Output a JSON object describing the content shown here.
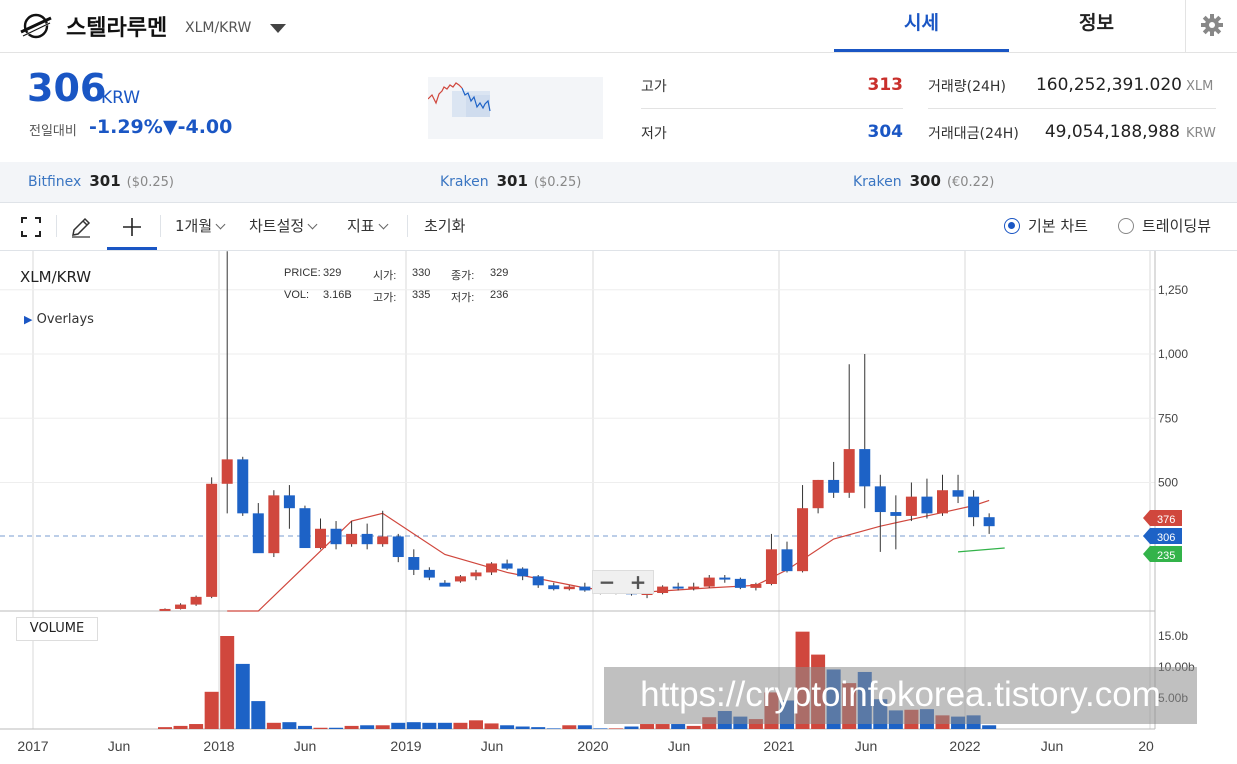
{
  "header": {
    "coin_name": "스텔라루멘",
    "pair": "XLM/KRW",
    "tabs": [
      "시세",
      "정보"
    ]
  },
  "quote": {
    "price": "306",
    "unit": "KRW",
    "change_label": "전일대비",
    "change_pct": "-1.29%",
    "change_abs": "▼-4.00",
    "high_label": "고가",
    "high": "313",
    "low_label": "저가",
    "low": "304",
    "volume_label": "거래량(24H)",
    "volume": "160,252,391.020",
    "volume_unit": "XLM",
    "turnover_label": "거래대금(24H)",
    "turnover": "49,054,188,988",
    "turnover_unit": "KRW"
  },
  "exchanges": [
    {
      "name": "Bitfinex",
      "price": "301",
      "sub": "($0.25)"
    },
    {
      "name": "Kraken",
      "price": "301",
      "sub": "($0.25)"
    },
    {
      "name": "Kraken",
      "price": "300",
      "sub": "(€0.22)"
    }
  ],
  "toolbar": {
    "period": "1개월",
    "chart_settings": "차트설정",
    "indicators": "지표",
    "reset": "초기화",
    "basic_chart": "기본 차트",
    "tradingview": "트레이딩뷰"
  },
  "chart_panel": {
    "title": "XLM/KRW",
    "overlays": "Overlays",
    "info": {
      "price_label": "PRICE:",
      "price": "329",
      "open_label": "시가:",
      "open": "330",
      "close_label": "종가:",
      "close": "329",
      "vol_label": "VOL:",
      "vol": "3.16B",
      "high_label": "고가:",
      "high": "335",
      "low_label": "저가:",
      "low": "236"
    },
    "volume_label": "VOLUME",
    "price_tags": {
      "upper": "376",
      "current": "306",
      "lower": "235"
    },
    "watermark": "https://cryptoinfokorea.tistory.com",
    "zoom_out": "−",
    "zoom_in": "+"
  },
  "colors": {
    "up": "#d0473d",
    "down": "#1d62c6",
    "accent": "#1a56c4",
    "ma": "#d0473d",
    "ma2": "#33b34a"
  },
  "chart_data": {
    "type": "candlestick",
    "title": "XLM/KRW",
    "x_ticks": [
      "2017",
      "Jun",
      "2018",
      "Jun",
      "2019",
      "Jun",
      "2020",
      "Jun",
      "2021",
      "Jun",
      "2022",
      "Jun",
      "20"
    ],
    "y_ticks": [
      "1,250",
      "1,000",
      "750",
      "500"
    ],
    "ylim": [
      -40,
      1400
    ],
    "volume_ticks": [
      "15.0b",
      "10.00b",
      "5.00b"
    ],
    "volume_max": 15.0,
    "start_month": "2017-11",
    "candles": [
      {
        "o": 5,
        "h": 10,
        "l": 3,
        "c": 8
      },
      {
        "o": 8,
        "h": 30,
        "l": 6,
        "c": 25
      },
      {
        "o": 25,
        "h": 60,
        "l": 20,
        "c": 55
      },
      {
        "o": 55,
        "h": 520,
        "l": 50,
        "c": 495
      },
      {
        "o": 495,
        "h": 1400,
        "l": 380,
        "c": 590
      },
      {
        "o": 590,
        "h": 600,
        "l": 370,
        "c": 380
      },
      {
        "o": 380,
        "h": 420,
        "l": 300,
        "c": 225
      },
      {
        "o": 225,
        "h": 470,
        "l": 210,
        "c": 450
      },
      {
        "o": 450,
        "h": 490,
        "l": 320,
        "c": 400
      },
      {
        "o": 400,
        "h": 410,
        "l": 250,
        "c": 245
      },
      {
        "o": 245,
        "h": 360,
        "l": 240,
        "c": 320
      },
      {
        "o": 320,
        "h": 350,
        "l": 240,
        "c": 260
      },
      {
        "o": 260,
        "h": 350,
        "l": 250,
        "c": 300
      },
      {
        "o": 300,
        "h": 340,
        "l": 240,
        "c": 260
      },
      {
        "o": 260,
        "h": 390,
        "l": 250,
        "c": 290
      },
      {
        "o": 290,
        "h": 300,
        "l": 190,
        "c": 210
      },
      {
        "o": 210,
        "h": 240,
        "l": 140,
        "c": 160
      },
      {
        "o": 160,
        "h": 170,
        "l": 120,
        "c": 130
      },
      {
        "o": 110,
        "h": 120,
        "l": 100,
        "c": 95
      },
      {
        "o": 115,
        "h": 140,
        "l": 110,
        "c": 135
      },
      {
        "o": 135,
        "h": 160,
        "l": 120,
        "c": 150
      },
      {
        "o": 150,
        "h": 190,
        "l": 140,
        "c": 185
      },
      {
        "o": 185,
        "h": 200,
        "l": 160,
        "c": 165
      },
      {
        "o": 165,
        "h": 170,
        "l": 120,
        "c": 135
      },
      {
        "o": 135,
        "h": 140,
        "l": 90,
        "c": 100
      },
      {
        "o": 100,
        "h": 110,
        "l": 80,
        "c": 85
      },
      {
        "o": 85,
        "h": 100,
        "l": 80,
        "c": 95
      },
      {
        "o": 95,
        "h": 110,
        "l": 75,
        "c": 80
      },
      {
        "o": 80,
        "h": 85,
        "l": 65,
        "c": 70
      },
      {
        "o": 70,
        "h": 80,
        "l": 65,
        "c": 75
      },
      {
        "o": 75,
        "h": 85,
        "l": 60,
        "c": 65
      },
      {
        "o": 65,
        "h": 80,
        "l": 50,
        "c": 70
      },
      {
        "o": 70,
        "h": 100,
        "l": 65,
        "c": 95
      },
      {
        "o": 95,
        "h": 110,
        "l": 80,
        "c": 90
      },
      {
        "o": 90,
        "h": 110,
        "l": 80,
        "c": 95
      },
      {
        "o": 95,
        "h": 140,
        "l": 90,
        "c": 130
      },
      {
        "o": 130,
        "h": 140,
        "l": 110,
        "c": 125
      },
      {
        "o": 125,
        "h": 130,
        "l": 85,
        "c": 90
      },
      {
        "o": 90,
        "h": 110,
        "l": 80,
        "c": 105
      },
      {
        "o": 105,
        "h": 300,
        "l": 100,
        "c": 240
      },
      {
        "o": 240,
        "h": 270,
        "l": 150,
        "c": 155
      },
      {
        "o": 155,
        "h": 490,
        "l": 150,
        "c": 400
      },
      {
        "o": 400,
        "h": 510,
        "l": 380,
        "c": 510
      },
      {
        "o": 510,
        "h": 580,
        "l": 440,
        "c": 460
      },
      {
        "o": 460,
        "h": 960,
        "l": 440,
        "c": 630
      },
      {
        "o": 630,
        "h": 1000,
        "l": 400,
        "c": 485
      },
      {
        "o": 485,
        "h": 530,
        "l": 230,
        "c": 385
      },
      {
        "o": 385,
        "h": 450,
        "l": 240,
        "c": 370
      },
      {
        "o": 370,
        "h": 500,
        "l": 350,
        "c": 445
      },
      {
        "o": 445,
        "h": 515,
        "l": 360,
        "c": 380
      },
      {
        "o": 380,
        "h": 530,
        "l": 370,
        "c": 470
      },
      {
        "o": 470,
        "h": 530,
        "l": 420,
        "c": 445
      },
      {
        "o": 445,
        "h": 470,
        "l": 330,
        "c": 365
      },
      {
        "o": 365,
        "h": 380,
        "l": 300,
        "c": 330
      }
    ],
    "volumes_b": [
      0.3,
      0.5,
      0.8,
      6.0,
      15.0,
      10.5,
      4.5,
      1.0,
      1.1,
      0.5,
      0.2,
      0.2,
      0.5,
      0.6,
      0.6,
      1.0,
      1.1,
      1.0,
      1.0,
      1.0,
      1.4,
      0.9,
      0.6,
      0.4,
      0.3,
      0.1,
      0.6,
      0.6,
      0.1,
      0.1,
      0.4,
      0.8,
      0.8,
      0.8,
      0.5,
      1.9,
      2.9,
      2.0,
      1.6,
      5.9,
      4.6,
      15.7,
      12.0,
      9.6,
      7.4,
      9.2,
      4.8,
      3.0,
      3.1,
      3.2,
      2.2,
      2.0,
      2.2,
      0.6
    ],
    "moving_average": [
      [
        4,
        0
      ],
      [
        6,
        0
      ],
      [
        12,
        350
      ],
      [
        14,
        380
      ],
      [
        18,
        220
      ],
      [
        22,
        150
      ],
      [
        27,
        90
      ],
      [
        30,
        70
      ],
      [
        35,
        90
      ],
      [
        38,
        100
      ],
      [
        40,
        160
      ],
      [
        43,
        280
      ],
      [
        46,
        330
      ],
      [
        49,
        370
      ],
      [
        52,
        410
      ],
      [
        53,
        430
      ]
    ],
    "moving_average_2": [
      [
        51,
        230
      ],
      [
        54,
        245
      ]
    ]
  }
}
